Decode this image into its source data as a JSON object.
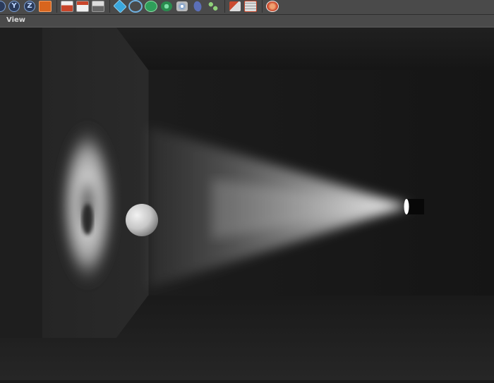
{
  "toolbar": {
    "axes": [
      "Y",
      "Z"
    ],
    "tools": [
      "x-axis-icon",
      "y-axis-icon",
      "z-axis-icon",
      "coordinate-system-icon",
      "render-view-icon",
      "render-picture-viewer-icon",
      "render-settings-icon",
      "cube-primitive-icon",
      "spline-icon",
      "nurbs-icon",
      "array-icon",
      "deformer-icon",
      "scene-object-icon",
      "field-icon",
      "camera-icon",
      "material-icon",
      "light-icon"
    ]
  },
  "view_menu": {
    "label": "View"
  },
  "scene": {
    "light_beam_color": "#d8d8d8",
    "background": "#141414",
    "objects": [
      "spot-light",
      "sphere",
      "volumetric-beam",
      "wall-projection",
      "room-walls"
    ]
  }
}
